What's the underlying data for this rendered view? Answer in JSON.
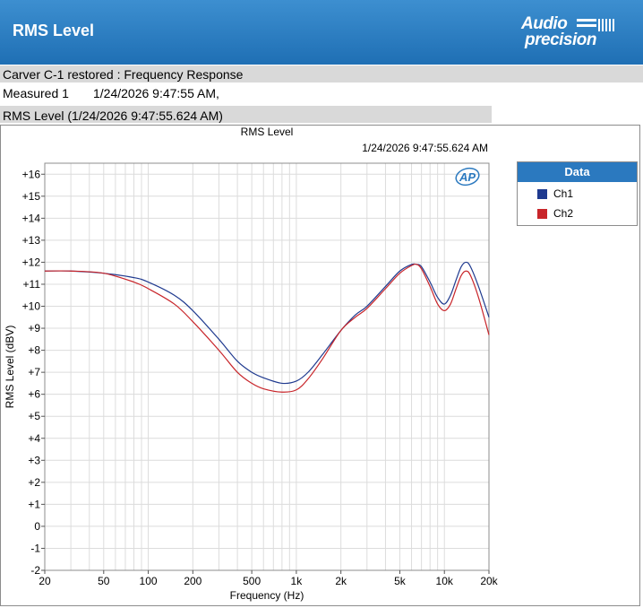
{
  "header": {
    "title": "RMS Level",
    "brand_line1": "Audio",
    "brand_line2": "precision"
  },
  "info": {
    "project": "Carver C-1 restored : Frequency Response",
    "measurement_label": "Measured 1",
    "measurement_time": "1/24/2026 9:47:55 AM,",
    "graph_tab": "RMS Level (1/24/2026 9:47:55.624 AM)"
  },
  "chart_data": {
    "type": "line",
    "title": "RMS Level",
    "subtitle": "1/24/2026 9:47:55.624 AM",
    "watermark": "AP",
    "xlabel": "Frequency (Hz)",
    "ylabel": "RMS Level (dBV)",
    "xscale": "log",
    "xlim": [
      20,
      20000
    ],
    "ylim": [
      -2,
      16.5
    ],
    "grid": true,
    "x_ticks": [
      20,
      50,
      100,
      200,
      500,
      1000,
      2000,
      5000,
      10000,
      20000
    ],
    "x_tick_labels": [
      "20",
      "50",
      "100",
      "200",
      "500",
      "1k",
      "2k",
      "5k",
      "10k",
      "20k"
    ],
    "y_ticks": [
      -2,
      -1,
      0,
      1,
      2,
      3,
      4,
      5,
      6,
      7,
      8,
      9,
      10,
      11,
      12,
      13,
      14,
      15,
      16
    ],
    "y_tick_labels": [
      "-2",
      "-1",
      "0",
      "+1",
      "+2",
      "+3",
      "+4",
      "+5",
      "+6",
      "+7",
      "+8",
      "+9",
      "+10",
      "+11",
      "+12",
      "+13",
      "+14",
      "+15",
      "+16"
    ],
    "legend": {
      "title": "Data",
      "position": "right"
    },
    "series": [
      {
        "name": "Ch1",
        "color": "#1f3a8f",
        "x": [
          20,
          30,
          50,
          80,
          100,
          150,
          200,
          300,
          400,
          500,
          600,
          800,
          1000,
          1200,
          1500,
          2000,
          2500,
          3000,
          4000,
          5000,
          6000,
          6500,
          7000,
          8000,
          9000,
          10000,
          11000,
          12000,
          13000,
          14000,
          15000,
          17000,
          20000
        ],
        "y": [
          11.6,
          11.6,
          11.5,
          11.3,
          11.1,
          10.5,
          9.8,
          8.5,
          7.5,
          7.0,
          6.75,
          6.5,
          6.6,
          7.0,
          7.8,
          8.9,
          9.6,
          10.0,
          10.9,
          11.6,
          11.9,
          11.9,
          11.8,
          11.1,
          10.4,
          10.1,
          10.5,
          11.2,
          11.8,
          12.0,
          11.8,
          10.9,
          9.5
        ]
      },
      {
        "name": "Ch2",
        "color": "#c8252a",
        "x": [
          20,
          30,
          50,
          80,
          100,
          150,
          200,
          300,
          400,
          500,
          600,
          800,
          1000,
          1200,
          1500,
          2000,
          2500,
          3000,
          4000,
          5000,
          6000,
          6500,
          7000,
          8000,
          9000,
          10000,
          11000,
          12000,
          13000,
          14000,
          15000,
          17000,
          20000
        ],
        "y": [
          11.6,
          11.6,
          11.5,
          11.1,
          10.8,
          10.1,
          9.3,
          8.0,
          7.0,
          6.5,
          6.25,
          6.1,
          6.2,
          6.7,
          7.6,
          8.9,
          9.5,
          9.9,
          10.8,
          11.5,
          11.85,
          11.9,
          11.7,
          10.9,
          10.1,
          9.8,
          10.1,
          10.8,
          11.4,
          11.6,
          11.4,
          10.4,
          8.7
        ]
      }
    ]
  }
}
